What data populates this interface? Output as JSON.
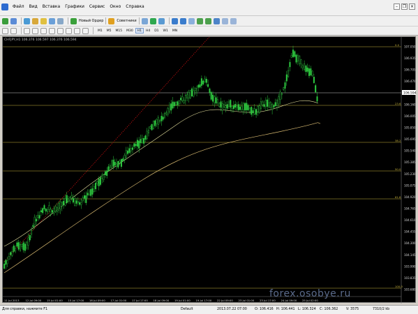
{
  "menu": {
    "items": [
      "Файл",
      "Вид",
      "Вставка",
      "Графики",
      "Сервис",
      "Окно",
      "Справка"
    ]
  },
  "toolbar": {
    "new_order_label": "Новый Ордер",
    "experts_label": "Советники",
    "timeframes": [
      "M1",
      "M5",
      "M15",
      "M30",
      "H1",
      "H4",
      "D1",
      "W1",
      "MN"
    ],
    "active_timeframe": "H1"
  },
  "chart": {
    "symbol_info": "CHFJPY,H1  106.376 106.597 106.376 106.594",
    "price_labels": [
      "107.050",
      "106.935",
      "106.705",
      "106.470",
      "106.315",
      "106.160",
      "106.005",
      "105.850",
      "105.695",
      "105.540",
      "105.385",
      "105.230",
      "105.075",
      "104.920",
      "104.765",
      "104.610",
      "104.455",
      "104.300",
      "104.145",
      "103.990",
      "103.835",
      "103.680"
    ],
    "current_price": "106.594",
    "fib_labels": [
      "0.0",
      "23.6",
      "38.2",
      "50.0",
      "61.8",
      "100.0"
    ],
    "time_labels": [
      "11 Jul 2013",
      "12 Jul 09:00",
      "15 Jul 01:00",
      "15 Jul 17:00",
      "16 Jul 09:00",
      "17 Jul 01:00",
      "17 Jul 17:00",
      "18 Jul 09:00",
      "19 Jul 01:00",
      "19 Jul 17:00",
      "22 Jul 09:00",
      "23 Jul 01:00",
      "23 Jul 17:00",
      "24 Jul 09:00",
      "25 Jul 02:00"
    ],
    "colors": {
      "background": "#000000",
      "candles": "#2ecc40",
      "fib_lines": "#c8b43c",
      "ma_slow": "#d7b970",
      "ma_fast": "#e8e3a0",
      "trend": "#d01010"
    },
    "watermark": "forex.osobye.ru"
  },
  "status": {
    "help": "Для справки, нажмите F1",
    "profile": "Default",
    "datetime": "2013.07.22 07:00",
    "open": "O: 106.416",
    "high": "H: 106.441",
    "low": "L: 106.324",
    "close": "C: 106.362",
    "volume": "V: 3575",
    "traffic": "7310/2 kb"
  }
}
